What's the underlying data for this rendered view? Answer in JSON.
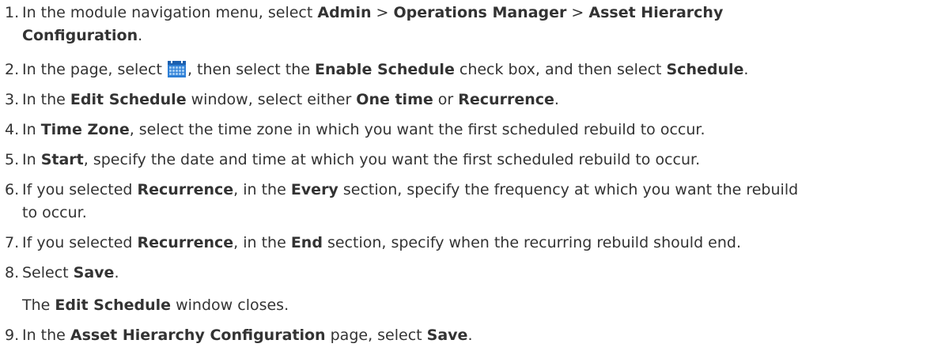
{
  "steps": [
    {
      "num": "1.",
      "t1": "In the module navigation menu, select ",
      "b1": "Admin",
      "t2": " > ",
      "b2": "Operations Manager",
      "t3": " > ",
      "b3": "Asset Hierarchy",
      "b4": "Configuration",
      "t4": "."
    },
    {
      "num": "2.",
      "t1": "In the page, select ",
      "icon": "calendar-icon",
      "t2": ", then select the ",
      "b1": "Enable Schedule",
      "t3": " check box, and then select ",
      "b2": "Schedule",
      "t4": "."
    },
    {
      "num": "3.",
      "t1": "In the ",
      "b1": "Edit Schedule",
      "t2": " window, select either ",
      "b2": "One time",
      "t3": " or ",
      "b3": "Recurrence",
      "t4": "."
    },
    {
      "num": "4.",
      "t1": "In ",
      "b1": "Time Zone",
      "t2": ", select the time zone in which you want the first scheduled rebuild to occur."
    },
    {
      "num": "5.",
      "t1": "In ",
      "b1": "Start",
      "t2": ", specify the date and time at which you want the first scheduled rebuild to occur."
    },
    {
      "num": "6.",
      "t1": "If you selected ",
      "b1": "Recurrence",
      "t2": ", in the ",
      "b2": "Every",
      "t3": " section, specify the frequency at which you want the rebuild",
      "t4": "to occur."
    },
    {
      "num": "7.",
      "t1": "If you selected ",
      "b1": "Recurrence",
      "t2": ", in the ",
      "b2": "End",
      "t3": " section, specify when the recurring rebuild should end."
    },
    {
      "num": "8.",
      "t1": "Select ",
      "b1": "Save",
      "t2": ".",
      "note_t1": "The ",
      "note_b1": "Edit Schedule",
      "note_t2": " window closes."
    },
    {
      "num": "9.",
      "t1": "In the ",
      "b1": "Asset Hierarchy Configuration",
      "t2": " page, select ",
      "b2": "Save",
      "t3": "."
    }
  ],
  "colors": {
    "text": "#333333",
    "icon_blue": "#2e7fd6",
    "icon_light": "#9cc8f2"
  }
}
